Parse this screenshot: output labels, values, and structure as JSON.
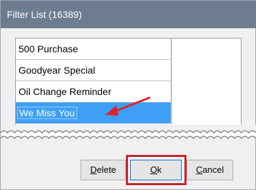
{
  "window": {
    "title": "Filter List (16389)"
  },
  "list": {
    "items": [
      {
        "label": "500 Purchase",
        "selected": false
      },
      {
        "label": "Goodyear Special",
        "selected": false
      },
      {
        "label": "Oil Change Reminder",
        "selected": false
      },
      {
        "label": "We Miss You",
        "selected": true
      }
    ]
  },
  "buttons": {
    "delete": {
      "accel": "D",
      "rest": "elete"
    },
    "ok": {
      "accel": "O",
      "rest": "k"
    },
    "cancel": {
      "accel": "C",
      "rest": "ancel"
    }
  },
  "colors": {
    "titlebar": "#6e7c8f",
    "selection": "#3d9ff5",
    "callout": "#c8232c"
  },
  "icons": [
    "pointer-arrow-icon"
  ]
}
